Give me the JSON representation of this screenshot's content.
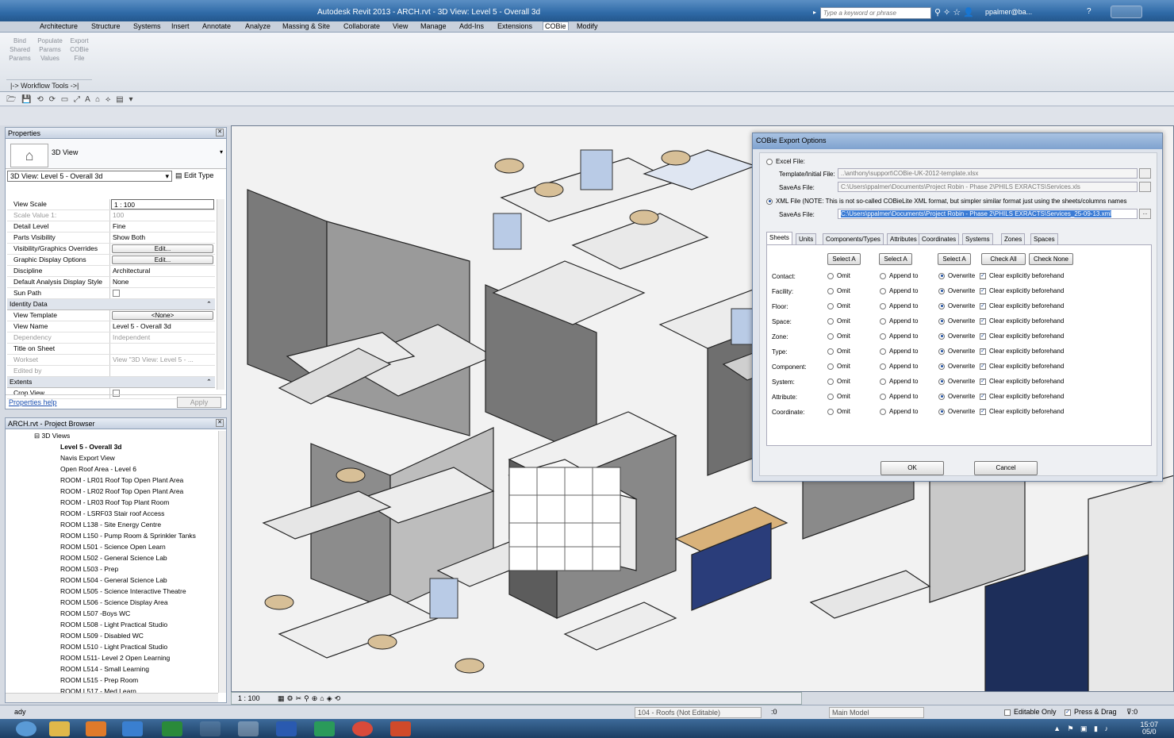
{
  "titlebar": {
    "title": "Autodesk Revit 2013 -   ARCH.rvt - 3D View: Level 5 - Overall 3d",
    "search_placeholder": "Type a keyword or phrase",
    "user": "ppalmer@ba...",
    "help": "?"
  },
  "tabs": [
    "Architecture",
    "Structure",
    "Systems",
    "Insert",
    "Annotate",
    "Analyze",
    "Massing & Site",
    "Collaborate",
    "View",
    "Manage",
    "Add-Ins",
    "Extensions",
    "COBie",
    "Modify"
  ],
  "ribbon": {
    "buttons": [
      {
        "l1": "Bind",
        "l2": "Shared",
        "l3": "Params"
      },
      {
        "l1": "Populate",
        "l2": "Params",
        "l3": "Values"
      },
      {
        "l1": "Export",
        "l2": "COBie",
        "l3": "File"
      }
    ],
    "panel": "|-> Workflow Tools ->|"
  },
  "properties": {
    "title": "Properties",
    "type_label": "3D View",
    "view_selector": "3D View: Level 5 - Overall 3d",
    "edit_type": "Edit Type",
    "rows": [
      {
        "k": "View Scale",
        "v": "1 : 100",
        "kind": "input"
      },
      {
        "k": "Scale Value    1:",
        "v": "100",
        "kind": "grey"
      },
      {
        "k": "Detail Level",
        "v": "Fine"
      },
      {
        "k": "Parts Visibility",
        "v": "Show Both"
      },
      {
        "k": "Visibility/Graphics Overrides",
        "v": "Edit...",
        "kind": "btn"
      },
      {
        "k": "Graphic Display Options",
        "v": "Edit...",
        "kind": "btn"
      },
      {
        "k": "Discipline",
        "v": "Architectural"
      },
      {
        "k": "Default Analysis Display Style",
        "v": "None"
      },
      {
        "k": "Sun Path",
        "v": "",
        "kind": "chk"
      }
    ],
    "section_identity": "Identity Data",
    "identity_rows": [
      {
        "k": "View Template",
        "v": "<None>",
        "kind": "btn"
      },
      {
        "k": "View Name",
        "v": "Level 5 - Overall 3d"
      },
      {
        "k": "Dependency",
        "v": "Independent",
        "kind": "grey"
      },
      {
        "k": "Title on Sheet",
        "v": ""
      },
      {
        "k": "Workset",
        "v": "View \"3D View: Level 5 - ...",
        "kind": "grey"
      },
      {
        "k": "Edited by",
        "v": "",
        "kind": "grey"
      }
    ],
    "section_extents": "Extents",
    "extent_rows": [
      {
        "k": "Crop View",
        "v": "",
        "kind": "chk"
      }
    ],
    "help_link": "Properties help",
    "apply": "Apply"
  },
  "browser": {
    "title": "ARCH.rvt - Project Browser",
    "root": "3D Views",
    "items": [
      "Level 5 - Overall 3d",
      "Navis Export View",
      "Open Roof Area - Level 6",
      "ROOM - LR01 Roof Top Open Plant Area",
      "ROOM - LR02 Roof Top Open Plant Area",
      "ROOM - LR03 Roof Top Plant Room",
      "ROOM - LSRF03 Stair roof Access",
      "ROOM L138 - Site Energy Centre",
      "ROOM L150 - Pump Room & Sprinkler Tanks",
      "ROOM L501 - Science Open Learn",
      "ROOM L502 - General Science Lab",
      "ROOM L503 - Prep",
      "ROOM L504 - General Science Lab",
      "ROOM L505 - Science Interactive Theatre",
      "ROOM L506 - Science Display Area",
      "ROOM L507 -Boys WC",
      "ROOM L508 - Light Practical Studio",
      "ROOM L509 - Disabled WC",
      "ROOM L510 - Light Practical Studio",
      "ROOM L511- Level 2 Open Learning",
      "ROOM L514 - Small Learning",
      "ROOM L515 - Prep Room",
      "ROOM L517 - Med Learn"
    ]
  },
  "viewbar": {
    "scale": "1 : 100"
  },
  "status": {
    "left": "ady",
    "workset": "104 - Roofs (Not Editable)",
    "count": ":0",
    "model": "Main Model",
    "editable": "Editable Only",
    "press": "Press & Drag",
    "filter": ":0"
  },
  "clock": {
    "time": "15:07",
    "date": "05/0"
  },
  "dialog": {
    "title": "COBie Export Options",
    "excel_label": "Excel File:",
    "template_label": "Template/Initial File:",
    "template_value": "..\\anthony\\support\\COBie-UK-2012-template.xlsx",
    "saveas_label": "SaveAs File:",
    "excel_saveas": "C:\\Users\\ppalmer\\Documents\\Project Robin - Phase 2\\PHILS EXRACTS\\Services.xls",
    "xml_label": "XML File (NOTE: This is not so-called COBieLite XML format, but simpler similar format just using the sheets/columns names",
    "xml_saveas": "C:\\Users\\ppalmer\\Documents\\Project Robin - Phase 2\\PHILS EXRACTS\\Services_25-09-13.xml",
    "browse": "...",
    "tabs": [
      "Sheets",
      "Units",
      "Components/Types",
      "Attributes",
      "Coordinates",
      "Systems",
      "Zones",
      "Spaces"
    ],
    "select_a": "Select A",
    "check_all": "Check All",
    "check_none": "Check None",
    "omit": "Omit",
    "append": "Append to",
    "overwrite": "Overwrite",
    "clear": "Clear explicitly beforehand",
    "rows": [
      "Contact:",
      "Facility:",
      "Floor:",
      "Space:",
      "Zone:",
      "Type:",
      "Component:",
      "System:",
      "Attribute:",
      "Coordinate:"
    ],
    "ok": "OK",
    "cancel": "Cancel"
  }
}
